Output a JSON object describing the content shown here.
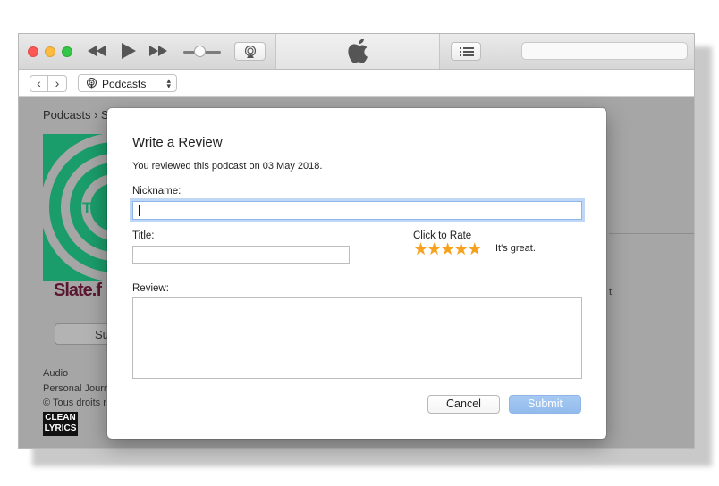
{
  "toolbar": {
    "rewind_icon": "rewind-icon",
    "play_icon": "play-icon",
    "fastforward_icon": "fast-forward-icon",
    "airplay_icon": "airplay-icon",
    "apple_logo": "apple-logo-icon",
    "list_icon": "list-icon",
    "volume_level": 0.35
  },
  "nav": {
    "back_glyph": "‹",
    "forward_glyph": "›",
    "source_label": "Podcasts",
    "source_chevron": "⌃⌄"
  },
  "background": {
    "breadcrumb": "Podcasts  ›  S",
    "artwork_label": "Slate.f",
    "artwork_overlay": "TRA",
    "subscribe_partial": "Su",
    "meta_genre": "Audio",
    "meta_title": "Personal Journ",
    "meta_copyright": "© Tous droits r",
    "clean_badge_top": "CLEAN",
    "clean_badge_bottom": "LYRICS",
    "right_text_partial": "t."
  },
  "dialog": {
    "title": "Write a Review",
    "subtitle": "You reviewed this podcast on 03 May 2018.",
    "nickname_label": "Nickname:",
    "nickname_value": "",
    "title_label": "Title:",
    "title_value": "",
    "review_label": "Review:",
    "review_value": "",
    "rate_label": "Click to Rate",
    "rating": 5,
    "rating_max": 5,
    "rating_text": "It's great.",
    "cancel_label": "Cancel",
    "submit_label": "Submit",
    "star_color": "#f6a21e",
    "accent_color": "#92bbec"
  }
}
